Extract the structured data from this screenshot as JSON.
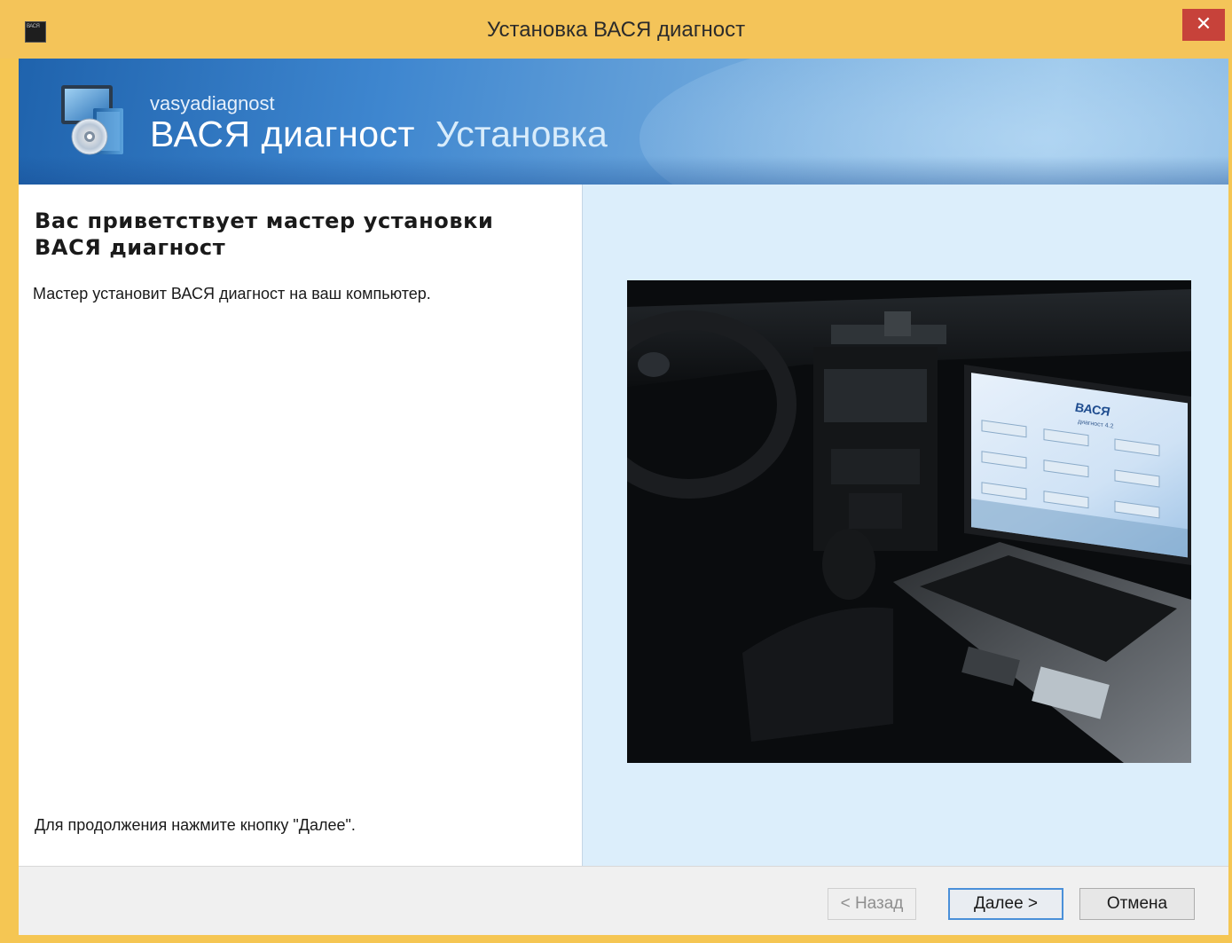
{
  "window": {
    "title": "Установка ВАСЯ диагност",
    "app_icon_text": "ВАСЯ",
    "close_symbol": "✕"
  },
  "banner": {
    "brand_small": "vasyadiagnost",
    "brand_big": "ВАСЯ диагност",
    "brand_install": "Установка"
  },
  "content": {
    "welcome_title": "Вас приветствует мастер установки ВАСЯ диагност",
    "welcome_desc": "Мастер установит ВАСЯ диагност на ваш компьютер.",
    "continue_hint": "Для продолжения нажмите кнопку \"Далее\".",
    "photo_laptop_logo": "ВАСЯ",
    "photo_laptop_sub": "диагност 4.2"
  },
  "buttons": {
    "back": "< Назад",
    "next": "Далее >",
    "cancel": "Отмена"
  },
  "colors": {
    "title_bar": "#f4c459",
    "close": "#c7423a",
    "banner": "#3e86cf",
    "right_panel": "#dceefb",
    "default_button_border": "#4a90d9"
  },
  "icons": [
    "app-icon",
    "close-icon",
    "installer-disc-icon"
  ]
}
